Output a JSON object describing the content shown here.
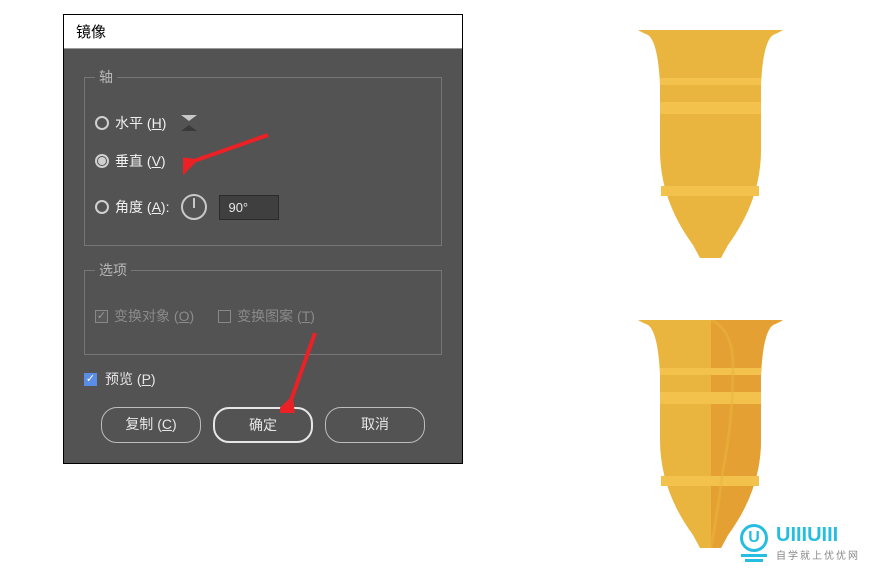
{
  "dialog": {
    "title": "镜像",
    "axis": {
      "legend": "轴",
      "horizontal": {
        "label_prefix": "水平 (",
        "key": "H",
        "label_suffix": ")",
        "selected": false
      },
      "vertical": {
        "label_prefix": "垂直 (",
        "key": "V",
        "label_suffix": ")",
        "selected": true
      },
      "angle": {
        "label_prefix": "角度 (",
        "key": "A",
        "label_suffix": "):",
        "value": "90°",
        "selected": false
      }
    },
    "options": {
      "legend": "选项",
      "transform_objects": {
        "label_prefix": "变换对象 (",
        "key": "O",
        "label_suffix": ")",
        "checked": true
      },
      "transform_patterns": {
        "label_prefix": "变换图案 (",
        "key": "T",
        "label_suffix": ")",
        "checked": false
      }
    },
    "preview": {
      "label_prefix": "预览 (",
      "key": "P",
      "label_suffix": ")",
      "checked": true
    },
    "buttons": {
      "copy": {
        "label_prefix": "复制 (",
        "key": "C",
        "label_suffix": ")"
      },
      "ok": "确定",
      "cancel": "取消"
    }
  },
  "watermark": {
    "brand": "UIIIUIII",
    "subtitle": "自学就上优优网"
  },
  "colors": {
    "arrow": "#eb2126",
    "vase_main": "#e9b53e",
    "vase_shadow": "#e4a032",
    "vase_band": "#f2c24d"
  }
}
